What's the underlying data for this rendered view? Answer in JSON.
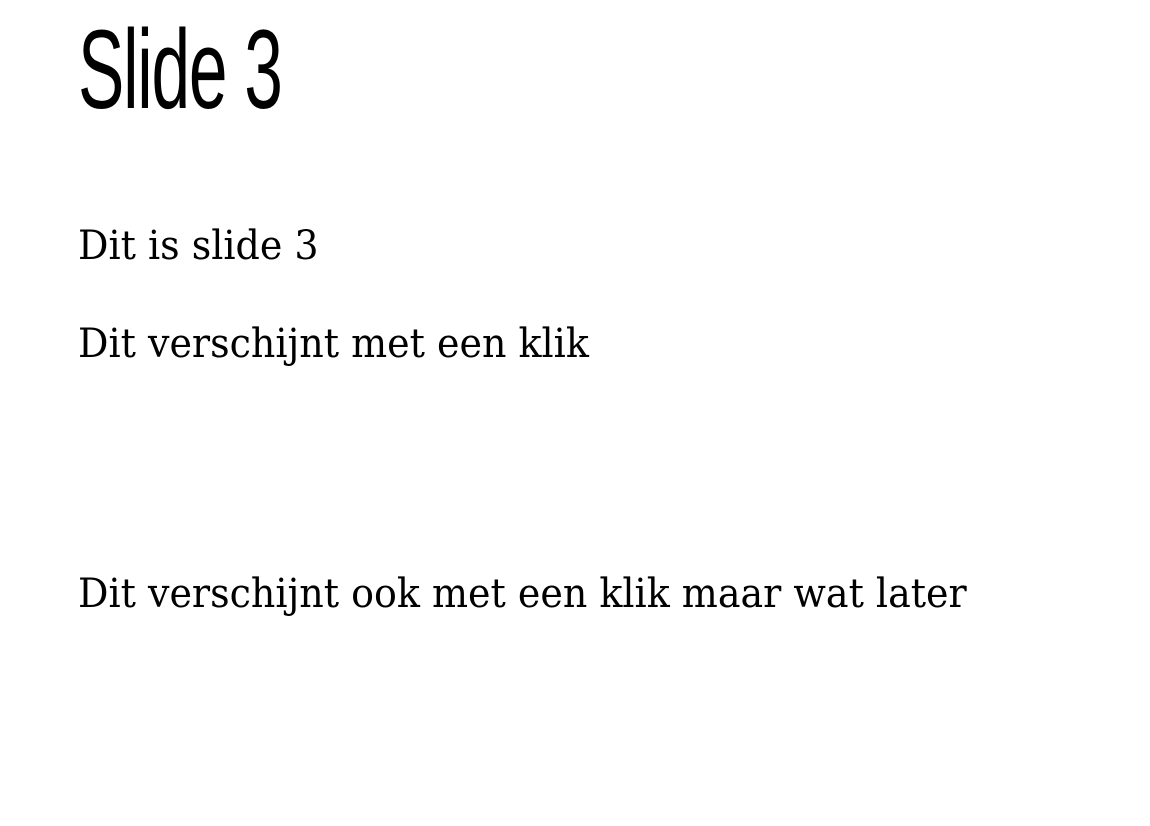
{
  "slide": {
    "title": "Slide 3",
    "paragraphs": [
      "Dit is slide 3",
      "Dit verschijnt met een klik",
      "Dit verschijnt ook met een klik maar wat later"
    ]
  }
}
